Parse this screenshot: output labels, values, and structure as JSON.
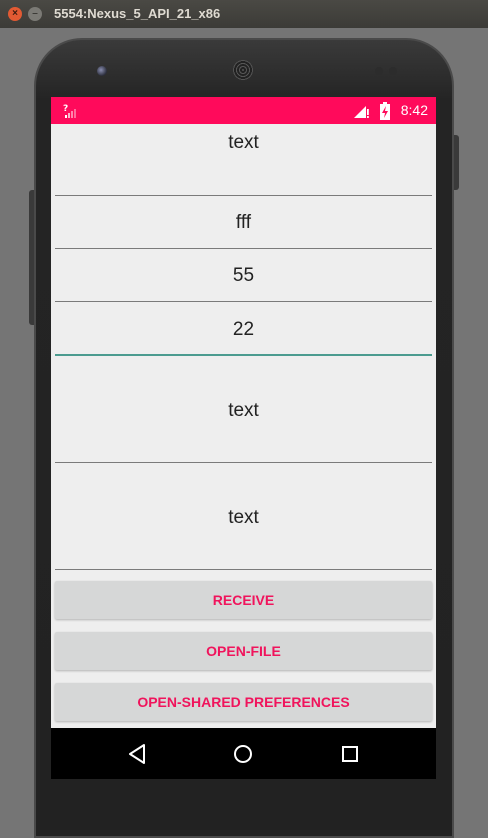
{
  "window": {
    "title": "5554:Nexus_5_API_21_x86",
    "close_glyph": "×",
    "minimize_glyph": "–"
  },
  "statusbar": {
    "time": "8:42",
    "background": "#ff0a5b",
    "icons": [
      "no-sim-signal-icon",
      "cell-signal-icon",
      "battery-charging-icon"
    ]
  },
  "fields": [
    {
      "value": "text"
    },
    {
      "value": "fff"
    },
    {
      "value": "55"
    },
    {
      "value": "22"
    },
    {
      "value": "text"
    },
    {
      "value": "text"
    }
  ],
  "buttons": [
    {
      "label": "RECEIVE"
    },
    {
      "label": "OPEN-FILE"
    },
    {
      "label": "OPEN-SHARED PREFERENCES"
    }
  ],
  "navbar": {
    "icons": [
      "back-icon",
      "home-icon",
      "recents-icon"
    ]
  },
  "colors": {
    "accent": "#f0145c",
    "focus_underline": "#4b9b8f",
    "button_bg": "#d6d7d7"
  }
}
